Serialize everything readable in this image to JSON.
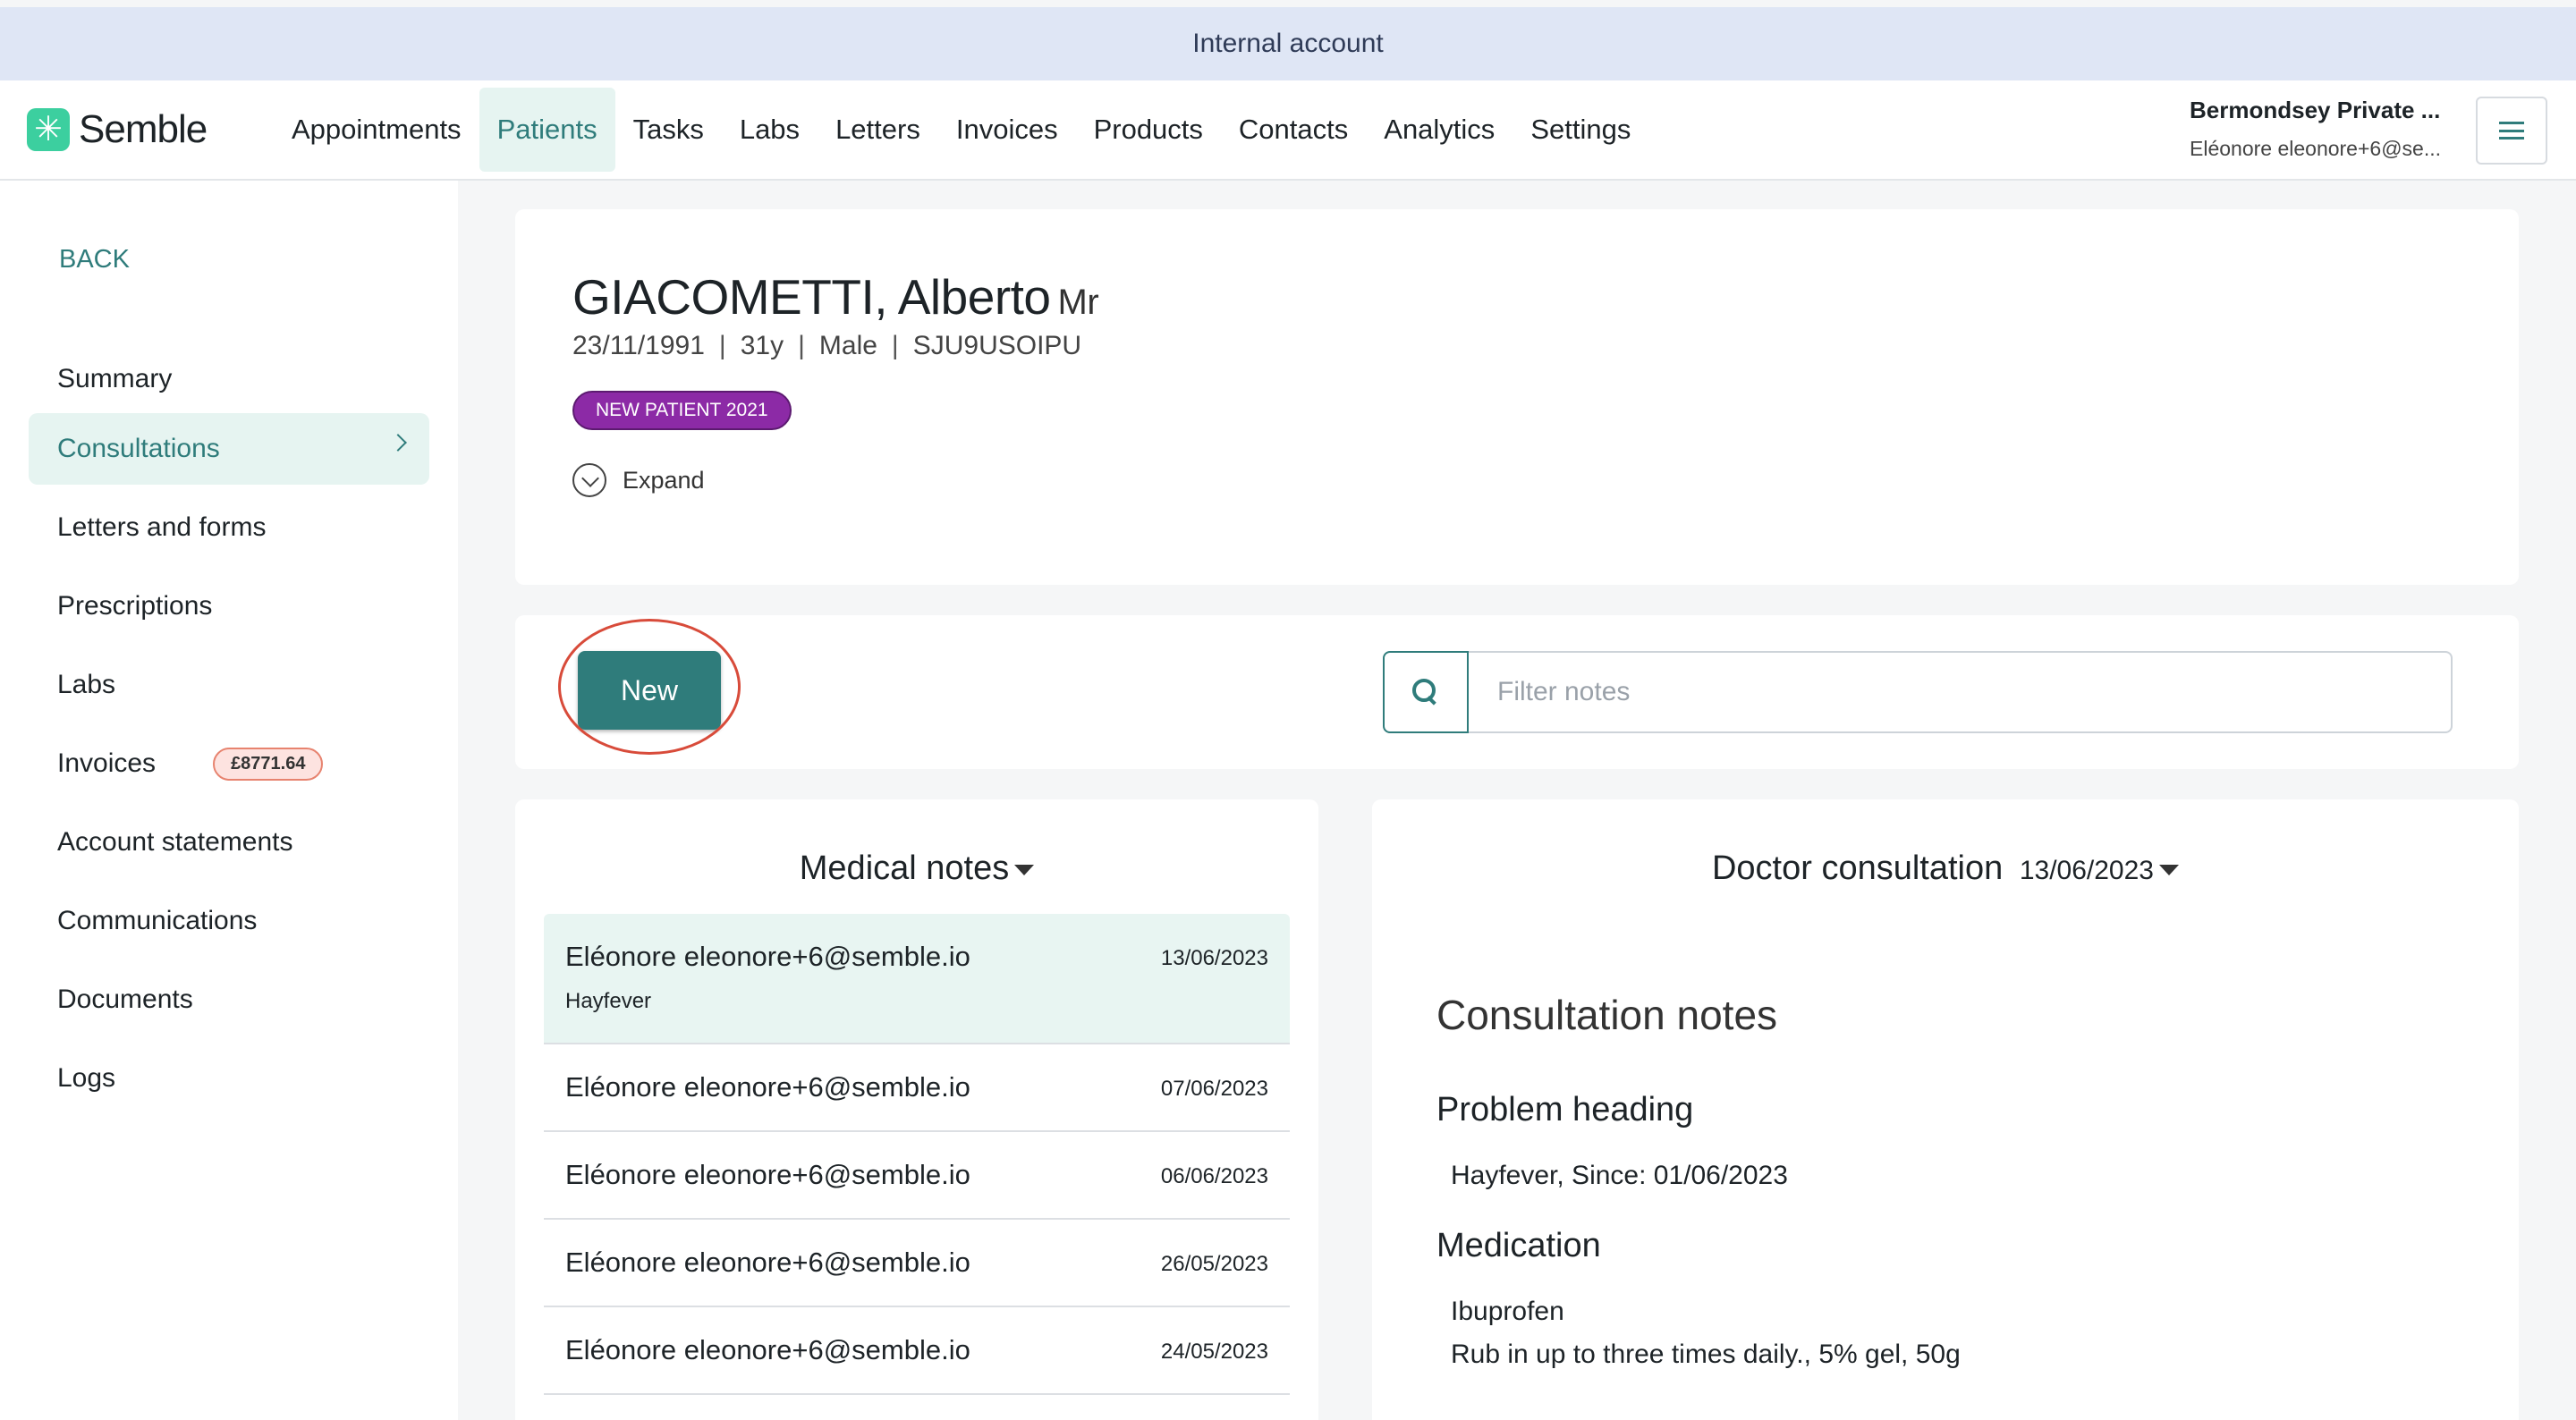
{
  "banner": {
    "text": "Internal account"
  },
  "brand": {
    "name": "Semble"
  },
  "nav": {
    "items": [
      {
        "label": "Appointments",
        "active": false
      },
      {
        "label": "Patients",
        "active": true
      },
      {
        "label": "Tasks",
        "active": false
      },
      {
        "label": "Labs",
        "active": false
      },
      {
        "label": "Letters",
        "active": false
      },
      {
        "label": "Invoices",
        "active": false
      },
      {
        "label": "Products",
        "active": false
      },
      {
        "label": "Contacts",
        "active": false
      },
      {
        "label": "Analytics",
        "active": false
      },
      {
        "label": "Settings",
        "active": false
      }
    ]
  },
  "account": {
    "practice": "Bermondsey Private ...",
    "user": "Eléonore eleonore+6@se..."
  },
  "sidebar": {
    "back": "BACK",
    "items": [
      {
        "label": "Summary"
      },
      {
        "label": "Consultations",
        "active": true
      },
      {
        "label": "Letters and forms"
      },
      {
        "label": "Prescriptions"
      },
      {
        "label": "Labs"
      },
      {
        "label": "Invoices",
        "badge": "£8771.64"
      },
      {
        "label": "Account statements"
      },
      {
        "label": "Communications"
      },
      {
        "label": "Documents"
      },
      {
        "label": "Logs"
      }
    ]
  },
  "patient": {
    "name": "GIACOMETTI, Alberto",
    "title": "Mr",
    "dob": "23/11/1991",
    "age": "31y",
    "gender": "Male",
    "id": "SJU9USOIPU",
    "tag": "NEW PATIENT 2021",
    "expand": "Expand"
  },
  "actions": {
    "new_label": "New",
    "filter_placeholder": "Filter notes"
  },
  "notes": {
    "title": "Medical notes",
    "items": [
      {
        "author": "Eléonore eleonore+6@semble.io",
        "date": "13/06/2023",
        "subtitle": "Hayfever",
        "selected": true
      },
      {
        "author": "Eléonore eleonore+6@semble.io",
        "date": "07/06/2023"
      },
      {
        "author": "Eléonore eleonore+6@semble.io",
        "date": "06/06/2023"
      },
      {
        "author": "Eléonore eleonore+6@semble.io",
        "date": "26/05/2023"
      },
      {
        "author": "Eléonore eleonore+6@semble.io",
        "date": "24/05/2023"
      }
    ]
  },
  "detail": {
    "title": "Doctor consultation",
    "date": "13/06/2023",
    "section": "Consultation notes",
    "problem_heading": "Problem heading",
    "problem_text": "Hayfever, Since: 01/06/2023",
    "medication_heading": "Medication",
    "medication_name": "Ibuprofen",
    "medication_dose": "Rub in up to three times daily., 5% gel, 50g"
  },
  "colors": {
    "brand": "#3ccf9f",
    "accent": "#2f7c7b",
    "tag": "#8c2aa6",
    "highlight": "#d84b3a"
  }
}
